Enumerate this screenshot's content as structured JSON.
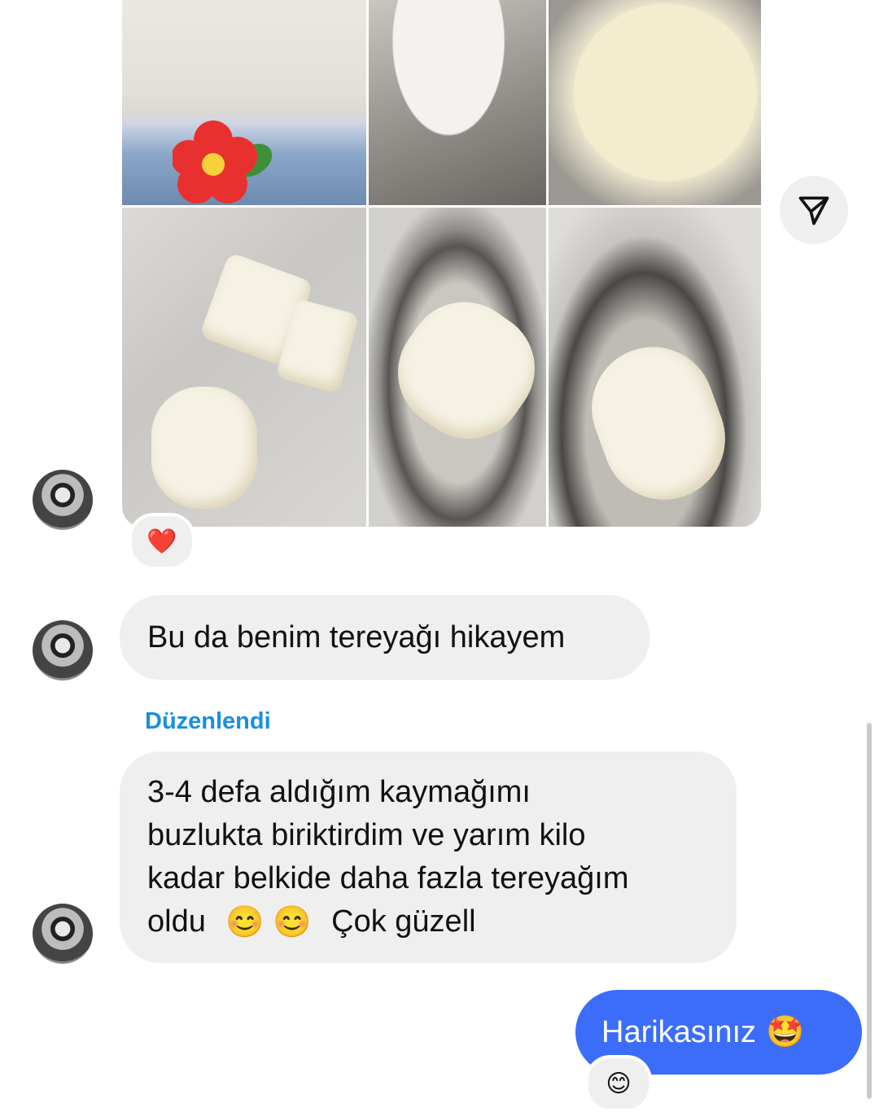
{
  "colors": {
    "incoming_bubble": "#efefef",
    "outgoing_bubble": "#3b6dfa",
    "edited_label": "#1a8fdc",
    "reaction_heart": "#e0243a"
  },
  "thread": {
    "photo_message": {
      "photo_count": 6,
      "reaction": "❤️"
    },
    "messages": [
      {
        "from": "other",
        "text": "Bu da benim tereyağı hikayem"
      },
      {
        "from": "other",
        "edited_label": "Düzenlendi",
        "lines": [
          "3-4 defa aldığım kaymağımı",
          "buzlukta biriktirdim ve yarım kilo",
          "kadar belkide daha fazla tereyağım",
          "oldu"
        ],
        "last_line_emojis": "😊 😊",
        "last_line_tail": "Çok güzell"
      },
      {
        "from": "me",
        "text": "Harikasınız",
        "emoji": "🤩",
        "reaction": "😊"
      }
    ]
  },
  "icons": {
    "share": "paper-plane-icon",
    "avatar": "user-avatar"
  }
}
